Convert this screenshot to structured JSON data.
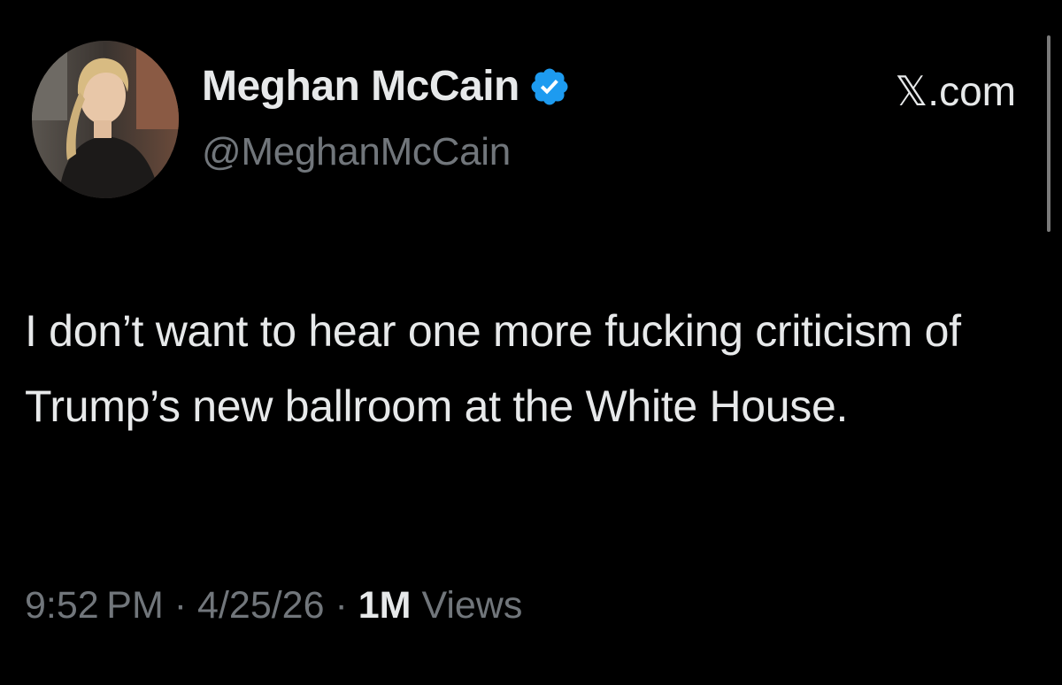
{
  "author": {
    "display_name": "Meghan McCain",
    "handle": "@MeghanMcCain",
    "verified_icon": "verified-badge-icon",
    "verified_color": "#1d9bf0"
  },
  "source": "𝕏.com",
  "tweet": {
    "text": "I don’t want to hear one more fucking criticism of Trump’s new ballroom at the White House."
  },
  "meta": {
    "time": "9:52 PM",
    "separator": "·",
    "date": "4/25/26",
    "views_count": "1M",
    "views_label": "Views"
  },
  "colors": {
    "background": "#000000",
    "primary_text": "#e7e9ea",
    "secondary_text": "#71767b"
  }
}
